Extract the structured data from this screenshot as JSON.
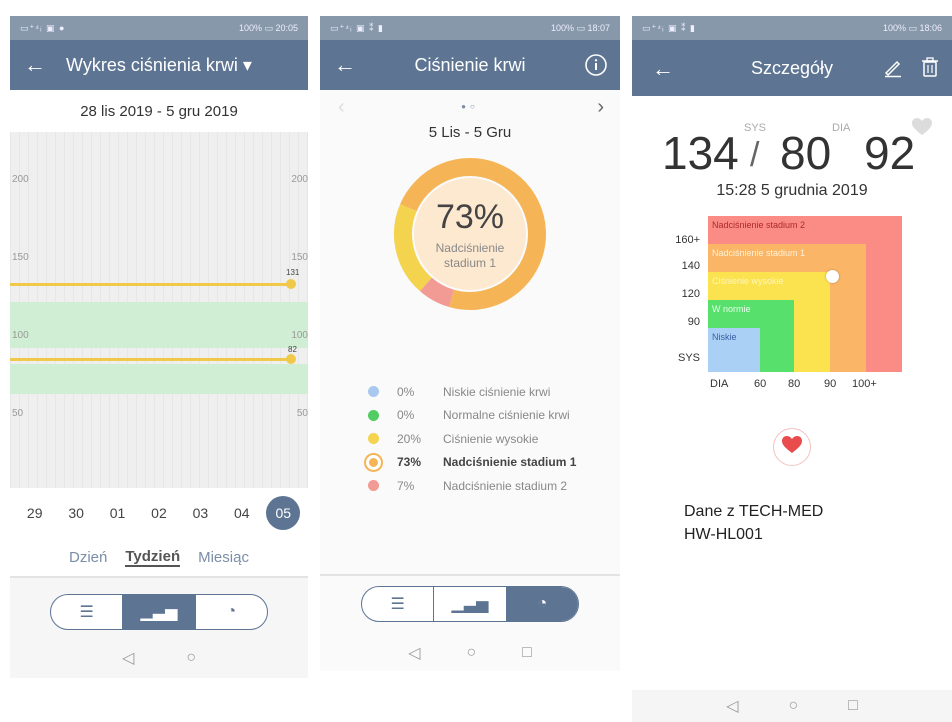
{
  "panel1": {
    "status_left": "▭⁺⁴ᵢ ▣ ● ",
    "status_right": "100% ▭ 20:05",
    "title": "Wykres ciśnienia krwi ▾",
    "date_range": "28 lis 2019 - 5 gru 2019",
    "y_ticks": [
      "200",
      "150",
      "100",
      "50"
    ],
    "line_values": [
      "131",
      "82"
    ],
    "days": [
      "29",
      "30",
      "01",
      "02",
      "03",
      "04",
      "05"
    ],
    "active_day": "05",
    "periods": [
      "Dzień",
      "Tydzień",
      "Miesiąc"
    ],
    "active_period": "Tydzień",
    "line_color": "#f0c94a",
    "normal_band_color": "#cfeed3"
  },
  "panel2": {
    "status_left": "▭⁺⁴ᵢ ▣ ⁑ ▮",
    "status_right": "100% ▭ 18:07",
    "title": "Ciśnienie krwi",
    "range": "5 Lis - 5 Gru",
    "donut_percent": "73%",
    "donut_category": "Nadciśnienie stadium 1",
    "legend": [
      {
        "pct": "0%",
        "label": "Niskie ciśnienie krwi",
        "color": "#a9c8ef",
        "value": 0
      },
      {
        "pct": "0%",
        "label": "Normalne ciśnienie krwi",
        "color": "#52cc63",
        "value": 0
      },
      {
        "pct": "20%",
        "label": "Ciśnienie wysokie",
        "color": "#f4d34e",
        "value": 20
      },
      {
        "pct": "73%",
        "label": "Nadciśnienie stadium 1",
        "color": "#f5b556",
        "value": 73
      },
      {
        "pct": "7%",
        "label": "Nadciśnienie stadium 2",
        "color": "#f29a94",
        "value": 7
      }
    ]
  },
  "panel3": {
    "status_left": "▭⁺⁴ᵢ ▣ ⁑ ▮",
    "status_right": "100% ▭ 18:06",
    "title": "Szczegóły",
    "sys": "134",
    "slash": "/",
    "dia": "80",
    "pulse": "92",
    "sys_label": "SYS",
    "dia_label": "DIA",
    "timestamp": "15:28 5 grudnia 2019",
    "zones": [
      {
        "label": "Nadciśnienie stadium 2",
        "color": "#fa8c85",
        "text_color": "#b02a2a"
      },
      {
        "label": "Nadciśnienie stadium 1",
        "color": "#fbb567",
        "text_color": "#fff2d6"
      },
      {
        "label": "Ciśnienie wysokie",
        "color": "#fbe24f",
        "text_color": "#fdf6c0"
      },
      {
        "label": "W normie",
        "color": "#58e06d",
        "text_color": "#e6ffe8"
      },
      {
        "label": "Niskie",
        "color": "#aad0f5",
        "text_color": "#3a5fa8"
      }
    ],
    "y_labels": [
      "160+",
      "140",
      "120",
      "90",
      "SYS"
    ],
    "x_labels": [
      "DIA",
      "60",
      "80",
      "90",
      "100+"
    ],
    "source_line1": "Dane z TECH-MED",
    "source_line2": "HW-HL001"
  },
  "nav": {
    "back": "◁",
    "home": "○",
    "recent": "□"
  },
  "segments": {
    "list": "☰",
    "bars": "▁▃▅",
    "pie": "◔"
  }
}
